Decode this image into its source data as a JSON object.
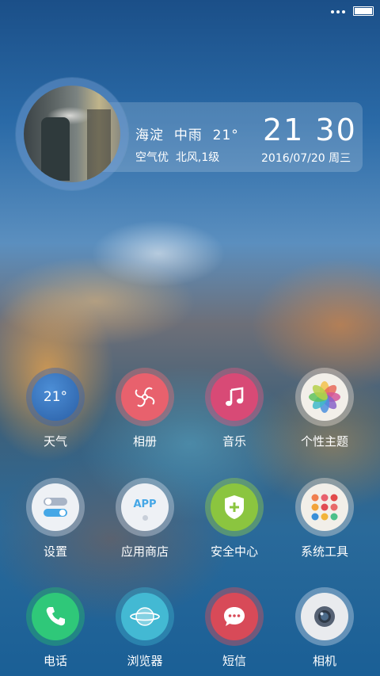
{
  "statusbar": {
    "signal_icon": "dots-icon",
    "battery_icon": "battery-icon"
  },
  "widget": {
    "location": "海淀",
    "condition": "中雨",
    "temperature": "21°",
    "air_quality": "空气优",
    "wind": "北风,1级",
    "time": "21 30",
    "date": "2016/07/20",
    "weekday": "周三"
  },
  "apps": [
    {
      "id": "weather",
      "label": "天气",
      "badge": "21°",
      "icon": "weather-icon"
    },
    {
      "id": "gallery",
      "label": "相册",
      "icon": "pinwheel-icon"
    },
    {
      "id": "music",
      "label": "音乐",
      "icon": "music-note-icon"
    },
    {
      "id": "themes",
      "label": "个性主题",
      "icon": "color-flower-icon"
    },
    {
      "id": "settings",
      "label": "设置",
      "icon": "toggle-switch-icon"
    },
    {
      "id": "appstore",
      "label": "应用商店",
      "badge": "APP",
      "icon": "app-store-icon"
    },
    {
      "id": "security",
      "label": "安全中心",
      "icon": "shield-plus-icon"
    },
    {
      "id": "tools",
      "label": "系统工具",
      "icon": "folder-grid-icon"
    }
  ],
  "dock": [
    {
      "id": "phone",
      "label": "电话",
      "icon": "phone-icon"
    },
    {
      "id": "browser",
      "label": "浏览器",
      "icon": "planet-icon"
    },
    {
      "id": "sms",
      "label": "短信",
      "icon": "message-bubble-icon"
    },
    {
      "id": "camera",
      "label": "相机",
      "icon": "camera-lens-icon"
    }
  ],
  "colors": {
    "weather": "#2f6fb8",
    "gallery": "#e8616d",
    "music": "#d84a76",
    "themes": "#f2efe9",
    "settings": "#eef1f5",
    "appstore": "#eef1f5",
    "security": "#8bc53f",
    "tools": "#f2efe9",
    "phone": "#2fc879",
    "browser": "#43b9d3",
    "sms": "#d84a58",
    "camera": "#e9ebee"
  }
}
